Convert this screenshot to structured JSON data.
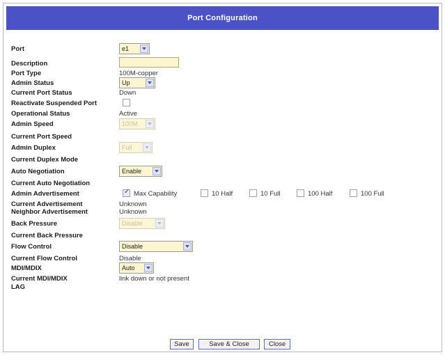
{
  "title": "Port Configuration",
  "fields": {
    "port": {
      "label": "Port",
      "value": "e1"
    },
    "description": {
      "label": "Description",
      "value": ""
    },
    "port_type": {
      "label": "Port Type",
      "value": "100M-copper"
    },
    "admin_status": {
      "label": "Admin Status",
      "value": "Up"
    },
    "current_port_status": {
      "label": "Current Port Status",
      "value": "Down"
    },
    "reactivate_suspended": {
      "label": "Reactivate Suspended Port",
      "checked": false
    },
    "operational_status": {
      "label": "Operational Status",
      "value": "Active"
    },
    "admin_speed": {
      "label": "Admin Speed",
      "value": "100M"
    },
    "current_port_speed": {
      "label": "Current Port Speed",
      "value": ""
    },
    "admin_duplex": {
      "label": "Admin Duplex",
      "value": "Full"
    },
    "current_duplex_mode": {
      "label": "Current Duplex Mode",
      "value": ""
    },
    "auto_negotiation": {
      "label": "Auto Negotiation",
      "value": "Enable"
    },
    "current_auto_negotiation": {
      "label": "Current Auto Negotiation",
      "value": ""
    },
    "admin_advertisement": {
      "label": "Admin Advertisement",
      "options": [
        {
          "label": "Max Capability",
          "checked": true
        },
        {
          "label": "10 Half",
          "checked": false
        },
        {
          "label": "10 Full",
          "checked": false
        },
        {
          "label": "100 Half",
          "checked": false
        },
        {
          "label": "100 Full",
          "checked": false
        }
      ]
    },
    "current_advertisement": {
      "label": "Current Advertisement",
      "value": "Unknown"
    },
    "neighbor_advertisement": {
      "label": "Neighbor Advertisement",
      "value": "Unknown"
    },
    "back_pressure": {
      "label": "Back Pressure",
      "value": "Disable"
    },
    "current_back_pressure": {
      "label": "Current Back Pressure",
      "value": ""
    },
    "flow_control": {
      "label": "Flow Control",
      "value": "Disable"
    },
    "current_flow_control": {
      "label": "Current Flow Control",
      "value": "Disable"
    },
    "mdi_mdix": {
      "label": "MDI/MDIX",
      "value": "Auto"
    },
    "current_mdi_mdix": {
      "label": "Current MDI/MDIX",
      "value": "link down or not present"
    },
    "lag": {
      "label": "LAG",
      "value": ""
    }
  },
  "buttons": {
    "save": "Save",
    "save_close": "Save & Close",
    "close": "Close"
  },
  "colors": {
    "title_bar": "#4a52c6",
    "input_bg": "#fbf6cf"
  }
}
